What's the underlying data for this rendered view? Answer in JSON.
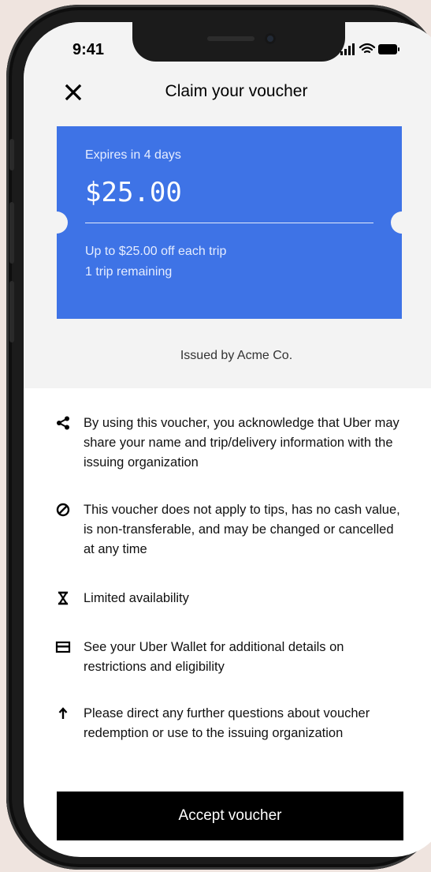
{
  "status_bar": {
    "time": "9:41"
  },
  "header": {
    "title": "Claim your voucher",
    "close_icon": "close-icon"
  },
  "voucher": {
    "expires": "Expires in 4 days",
    "amount": "$25.00",
    "detail_line1": "Up to $25.00 off each trip",
    "detail_line2": "1 trip remaining",
    "color": "#3e73e6"
  },
  "issuer": "Issued by Acme Co.",
  "terms": [
    {
      "icon": "share-icon",
      "text": "By using this voucher, you acknowledge that Uber may share your name and trip/delivery information with the issuing organization"
    },
    {
      "icon": "prohibited-icon",
      "text": "This voucher does not apply to tips, has no cash value, is non-transferable, and may be changed or cancelled at any time"
    },
    {
      "icon": "hourglass-icon",
      "text": "Limited availability"
    },
    {
      "icon": "wallet-icon",
      "text": "See your Uber Wallet for additional details on restrictions and eligibility"
    },
    {
      "icon": "arrow-up-icon",
      "text": "Please direct any further questions about voucher redemption or use to the issuing organization"
    }
  ],
  "accept_label": "Accept voucher"
}
